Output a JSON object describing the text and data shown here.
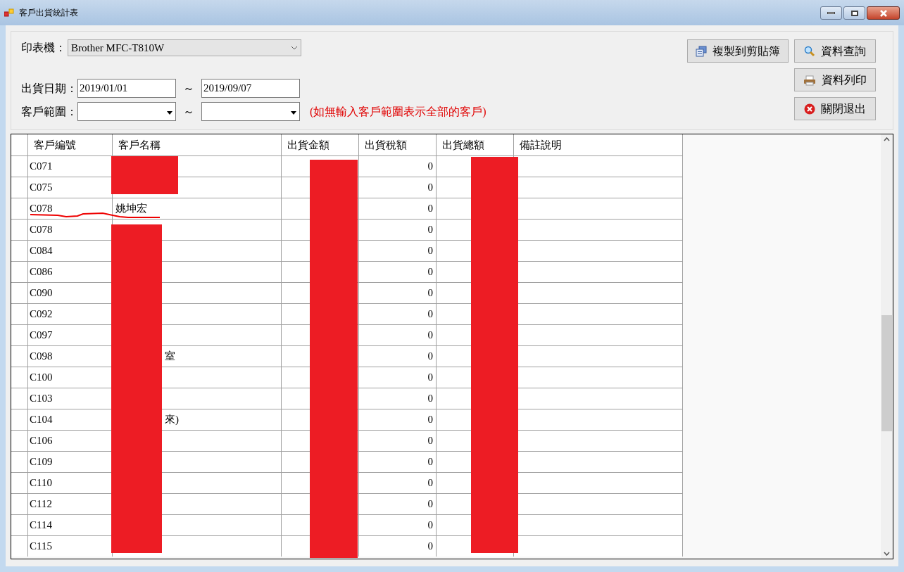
{
  "window": {
    "title": "客戶出貨統計表"
  },
  "printer": {
    "label": "印表機：",
    "value": "Brother MFC-T810W"
  },
  "date_range": {
    "label": "出貨日期：",
    "from": "2019/01/01",
    "separator": "～",
    "to": "2019/09/07"
  },
  "customer_range": {
    "label": "客戶範圍：",
    "separator": "～",
    "hint": "(如無輸入客戶範圍表示全部的客戶)"
  },
  "buttons": [
    {
      "label": "複製到剪貼簿",
      "kind": "copy"
    },
    {
      "label": "資料查詢",
      "kind": "search"
    },
    {
      "label": "資料列印",
      "kind": "print"
    },
    {
      "label": "關閉退出",
      "kind": "close"
    }
  ],
  "table": {
    "columns": [
      "客戶編號",
      "客戶名稱",
      "出貨金額",
      "出貨稅額",
      "出貨總額",
      "備註說明"
    ],
    "rows": [
      {
        "id": "C071",
        "tax": "0"
      },
      {
        "id": "C075",
        "tax": "0"
      },
      {
        "id": "C078",
        "name": "姚坤宏",
        "tax": "0"
      },
      {
        "id": "C078",
        "tax": "0"
      },
      {
        "id": "C084",
        "tax": "0"
      },
      {
        "id": "C086",
        "tax": "0"
      },
      {
        "id": "C090",
        "tax": "0"
      },
      {
        "id": "C092",
        "tax": "0"
      },
      {
        "id": "C097",
        "tax": "0"
      },
      {
        "id": "C098",
        "name": "室",
        "tax": "0"
      },
      {
        "id": "C100",
        "tax": "0"
      },
      {
        "id": "C103",
        "tax": "0"
      },
      {
        "id": "C104",
        "name": "來)",
        "tax": "0"
      },
      {
        "id": "C106",
        "tax": "0"
      },
      {
        "id": "C109",
        "tax": "0"
      },
      {
        "id": "C110",
        "tax": "0"
      },
      {
        "id": "C112",
        "tax": "0"
      },
      {
        "id": "C114",
        "tax": "0"
      },
      {
        "id": "C115",
        "tax": "0"
      }
    ]
  }
}
